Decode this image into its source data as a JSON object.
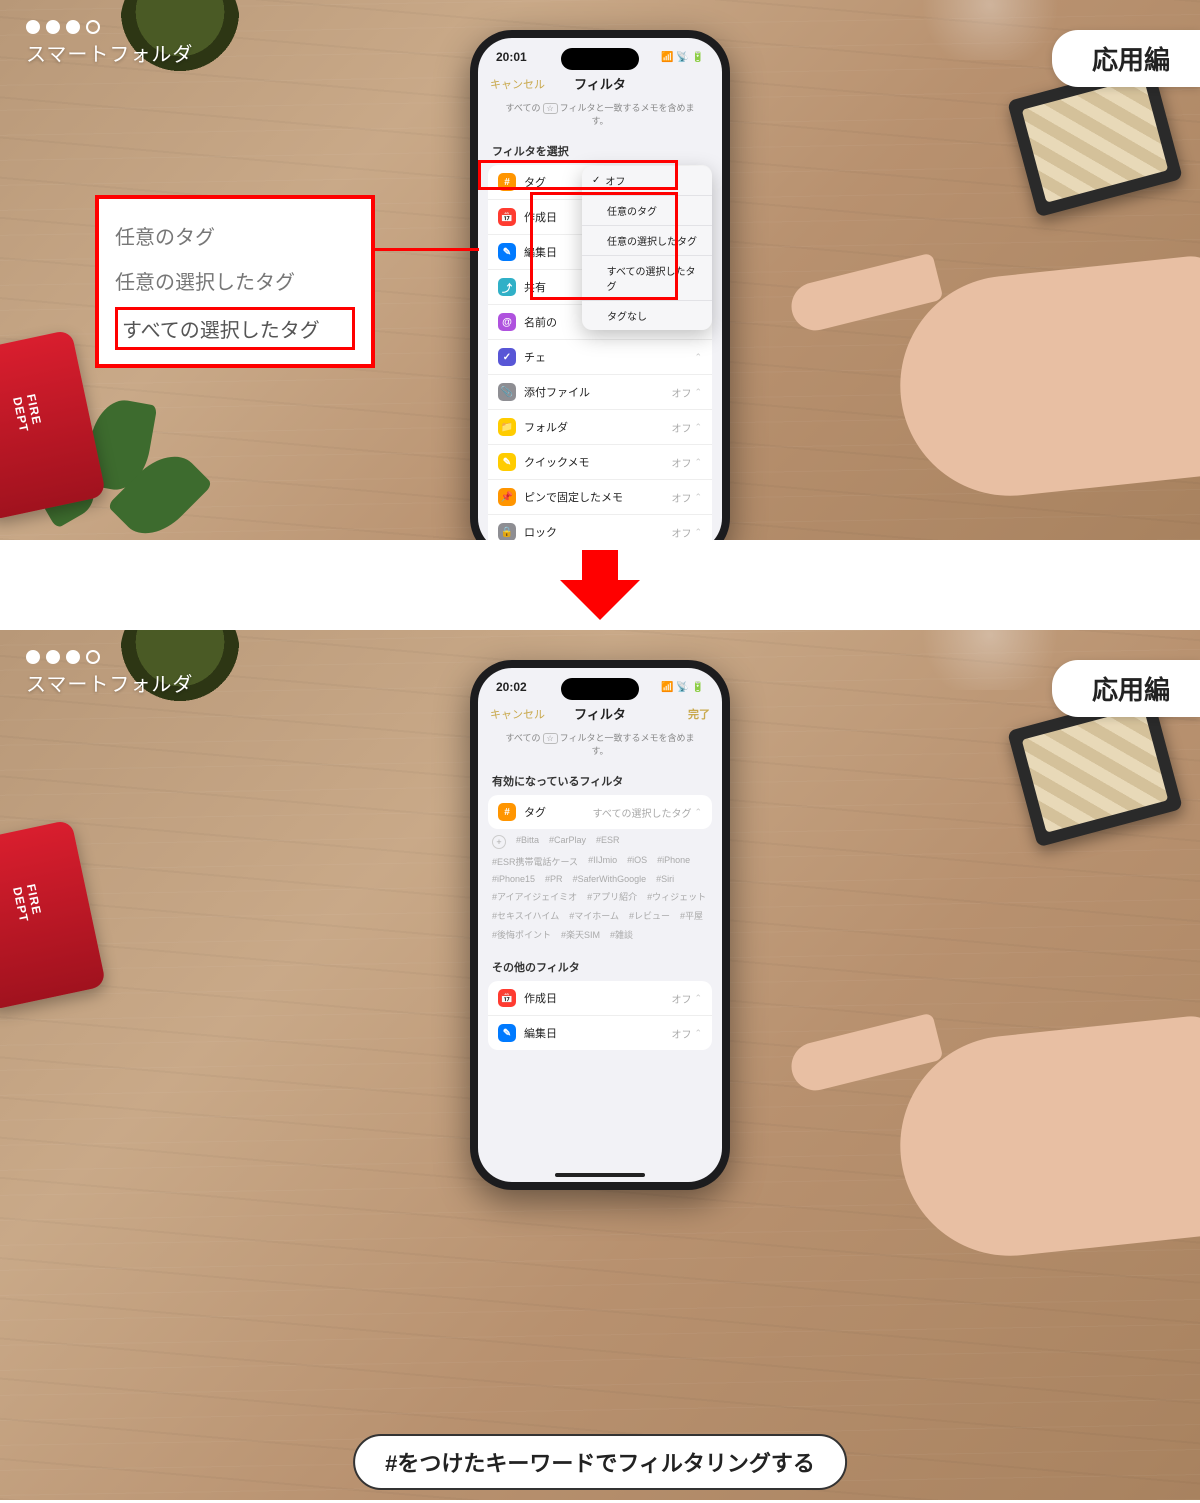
{
  "overlay": {
    "corner_label": "スマートフォルダ",
    "corner_pill": "応用編",
    "caption": "#をつけたキーワードでフィルタリングする"
  },
  "panel1": {
    "time": "20:01",
    "nav": {
      "cancel": "キャンセル",
      "title": "フィルタ",
      "done": ""
    },
    "sub_prefix": "すべての",
    "sub_pop": "☆",
    "sub_suffix": "フィルタと一致するメモを含めます。",
    "section": "フィルタを選択",
    "rows": [
      {
        "icon": "#",
        "cls": "ic-orange",
        "label": "タグ",
        "value": "オフ"
      },
      {
        "icon": "📅",
        "cls": "ic-red",
        "label": "作成日",
        "value": ""
      },
      {
        "icon": "✎",
        "cls": "ic-blue",
        "label": "編集日",
        "value": ""
      },
      {
        "icon": "⤴",
        "cls": "ic-teal",
        "label": "共有",
        "value": ""
      },
      {
        "icon": "@",
        "cls": "ic-purple",
        "label": "名前の",
        "value": ""
      },
      {
        "icon": "✓",
        "cls": "ic-indigo",
        "label": "チェ",
        "value": ""
      },
      {
        "icon": "📎",
        "cls": "ic-gray",
        "label": "添付ファイル",
        "value": "オフ"
      },
      {
        "icon": "📁",
        "cls": "ic-yellow",
        "label": "フォルダ",
        "value": "オフ"
      },
      {
        "icon": "✎",
        "cls": "ic-yellow",
        "label": "クイックメモ",
        "value": "オフ"
      },
      {
        "icon": "📌",
        "cls": "ic-orange",
        "label": "ピンで固定したメモ",
        "value": "オフ"
      },
      {
        "icon": "🔒",
        "cls": "ic-gray",
        "label": "ロック",
        "value": "オフ"
      }
    ],
    "popover": [
      {
        "check": true,
        "label": "オフ"
      },
      {
        "check": false,
        "label": "任意のタグ"
      },
      {
        "check": false,
        "label": "任意の選択したタグ"
      },
      {
        "check": false,
        "label": "すべての選択したタグ"
      },
      {
        "check": false,
        "label": "タグなし"
      }
    ],
    "callout": {
      "opt1": "任意のタグ",
      "opt2": "任意の選択したタグ",
      "opt3": "すべての選択したタグ"
    }
  },
  "panel2": {
    "time": "20:02",
    "nav": {
      "cancel": "キャンセル",
      "title": "フィルタ",
      "done": "完了"
    },
    "sub_prefix": "すべての",
    "sub_pop": "☆",
    "sub_suffix": "フィルタと一致するメモを含めます。",
    "section_active": "有効になっているフィルタ",
    "active_row": {
      "icon": "#",
      "cls": "ic-orange",
      "label": "タグ",
      "value": "すべての選択したタグ"
    },
    "chips": [
      "+",
      "#Bitta",
      "#CarPlay",
      "#ESR",
      "#ESR携帯電話ケース",
      "#IIJmio",
      "#iOS",
      "#iPhone",
      "#iPhone15",
      "#PR",
      "#SaferWithGoogle",
      "#Siri",
      "#アイアイジェイミオ",
      "#アプリ紹介",
      "#ウィジェット",
      "#セキスイハイム",
      "#マイホーム",
      "#レビュー",
      "#平屋",
      "#後悔ポイント",
      "#楽天SIM",
      "#雑談"
    ],
    "section_other": "その他のフィルタ",
    "other_rows": [
      {
        "icon": "📅",
        "cls": "ic-red",
        "label": "作成日",
        "value": "オフ"
      },
      {
        "icon": "✎",
        "cls": "ic-blue",
        "label": "編集日",
        "value": "オフ"
      }
    ]
  }
}
